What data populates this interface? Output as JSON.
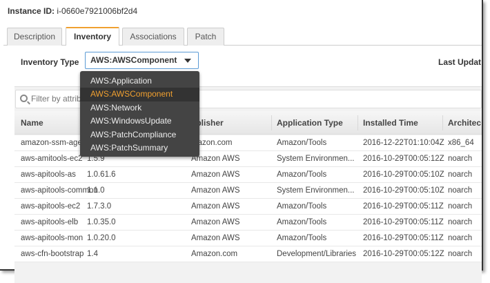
{
  "instance": {
    "label": "Instance ID:",
    "value": "i-0660e7921006bf2d4"
  },
  "tabs": [
    {
      "label": "Description"
    },
    {
      "label": "Inventory"
    },
    {
      "label": "Associations"
    },
    {
      "label": "Patch"
    }
  ],
  "inventory_type": {
    "label": "Inventory Type",
    "selected": "AWS:AWSComponent",
    "options": [
      "AWS:Application",
      "AWS:AWSComponent",
      "AWS:Network",
      "AWS:WindowsUpdate",
      "AWS:PatchCompliance",
      "AWS:PatchSummary"
    ]
  },
  "last_updated_label": "Last Updat",
  "filter": {
    "placeholder": "Filter by attribu"
  },
  "table": {
    "headers": [
      "Name",
      "",
      "ublisher",
      "Application Type",
      "Installed Time",
      "Architec"
    ],
    "rows": [
      [
        "amazon-ssm-ager",
        "",
        "mazon.com",
        "Amazon/Tools",
        "2016-12-22T01:10:04Z",
        "x86_64"
      ],
      [
        "aws-amitools-ec2",
        "1.5.9",
        "Amazon AWS",
        "System Environmen...",
        "2016-10-29T00:05:12Z",
        "noarch"
      ],
      [
        "aws-apitools-as",
        "1.0.61.6",
        "Amazon AWS",
        "Amazon/Tools",
        "2016-10-29T00:05:10Z",
        "noarch"
      ],
      [
        "aws-apitools-common",
        "1.1.0",
        "Amazon AWS",
        "System Environmen...",
        "2016-10-29T00:05:10Z",
        "noarch"
      ],
      [
        "aws-apitools-ec2",
        "1.7.3.0",
        "Amazon AWS",
        "Amazon/Tools",
        "2016-10-29T00:05:11Z",
        "noarch"
      ],
      [
        "aws-apitools-elb",
        "1.0.35.0",
        "Amazon AWS",
        "Amazon/Tools",
        "2016-10-29T00:05:11Z",
        "noarch"
      ],
      [
        "aws-apitools-mon",
        "1.0.20.0",
        "Amazon AWS",
        "Amazon/Tools",
        "2016-10-29T00:05:11Z",
        "noarch"
      ],
      [
        "aws-cfn-bootstrap",
        "1.4",
        "Amazon.com",
        "Development/Libraries",
        "2016-10-29T00:05:12Z",
        "noarch"
      ]
    ]
  },
  "colors": {
    "accent": "#f0a030",
    "dropdown_bg": "#444444"
  }
}
